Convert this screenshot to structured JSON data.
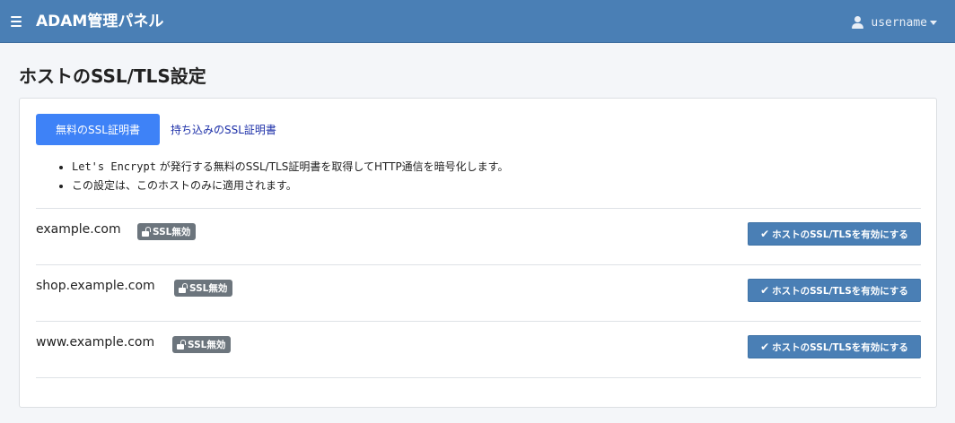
{
  "navbar": {
    "brand": "ADAM管理パネル",
    "username": "username",
    "menu_icon": "hamburger-icon",
    "user_icon": "user-icon"
  },
  "page_title": "ホストのSSL/TLS設定",
  "tabs": {
    "active": "無料のSSL証明書",
    "other": "持ち込みのSSL証明書"
  },
  "notes": {
    "line1_code": "Let's Encrypt",
    "line1_text": " が発行する無料のSSL/TLS証明書を取得してHTTP通信を暗号化します。",
    "line2": "この設定は、このホストのみに適用されます。"
  },
  "hosts": [
    {
      "name": "example.com",
      "badge": "SSL無効",
      "button": "ホストのSSL/TLSを有効にする"
    },
    {
      "name": "shop.example.com",
      "badge": "SSL無効",
      "button": "ホストのSSL/TLSを有効にする"
    },
    {
      "name": "www.example.com",
      "badge": "SSL無効",
      "button": "ホストのSSL/TLSを有効にする"
    }
  ],
  "colors": {
    "navbar": "#4a7fb5",
    "active_tab": "#3e82f7",
    "badge": "#6c757d",
    "link": "#1c2fa8"
  }
}
